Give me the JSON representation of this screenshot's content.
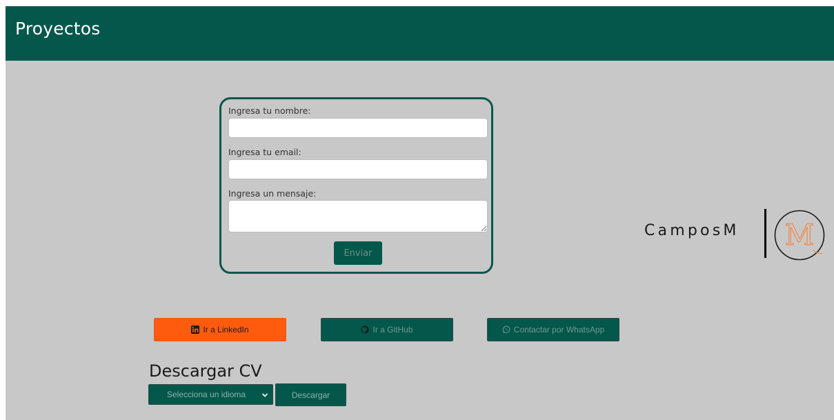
{
  "header": {
    "title": "Proyectos"
  },
  "form": {
    "name_label": "Ingresa tu nombre:",
    "name_value": "",
    "email_label": "Ingresa tu email:",
    "email_value": "",
    "message_label": "Ingresa un mensaje:",
    "message_value": "",
    "submit_label": "Enviar"
  },
  "logo": {
    "text": "CamposM",
    "mark_letter": "M"
  },
  "social": {
    "linkedin_label": "Ir a LinkedIn",
    "github_label": "Ir a GitHub",
    "whatsapp_label": "Contactar por WhatsApp"
  },
  "cv": {
    "title": "Descargar CV",
    "select_value": "Selecciona un idioma",
    "download_label": "Descargar"
  },
  "colors": {
    "primary": "#04574b",
    "background": "#c8c8c8",
    "linkedin": "#ff5b0f",
    "logo_accent": "#f08a4b"
  }
}
